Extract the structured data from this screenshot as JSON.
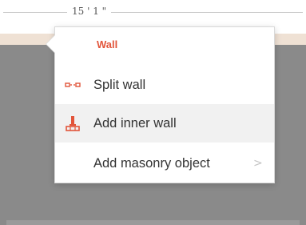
{
  "canvas": {
    "dimension_label": "15 ' 1 \""
  },
  "context_menu": {
    "title": "Wall",
    "items": [
      {
        "label": "Split wall",
        "icon": "split-wall-icon"
      },
      {
        "label": "Add inner wall",
        "icon": "inner-wall-icon"
      },
      {
        "label": "Add masonry object",
        "icon": "",
        "submenu_indicator": ">"
      }
    ]
  },
  "colors": {
    "accent": "#e2553b",
    "wall_band": "#efe1d4",
    "floor": "#8a8a8a"
  }
}
